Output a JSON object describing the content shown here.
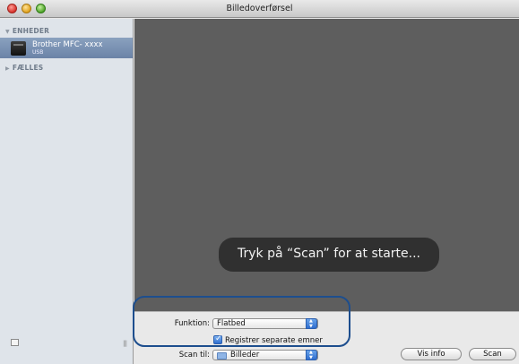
{
  "window": {
    "title": "Billedoverførsel"
  },
  "sidebar": {
    "devices_header": "ENHEDER",
    "device": {
      "name": "Brother MFC- xxxx",
      "connection": "USB"
    },
    "shared_header": "FÆLLES"
  },
  "preview": {
    "hint": "Tryk på “Scan” for at starte..."
  },
  "controls": {
    "function_label": "Funktion:",
    "function_value": "Flatbed",
    "separate_items_label": "Registrer separate emner",
    "separate_items_checked": true,
    "scan_to_label": "Scan til:",
    "scan_to_value": "Billeder",
    "info_button": "Vis info",
    "scan_button": "Scan"
  },
  "colors": {
    "highlight": "#1d4e8e",
    "accent": "#2f6ecf"
  }
}
